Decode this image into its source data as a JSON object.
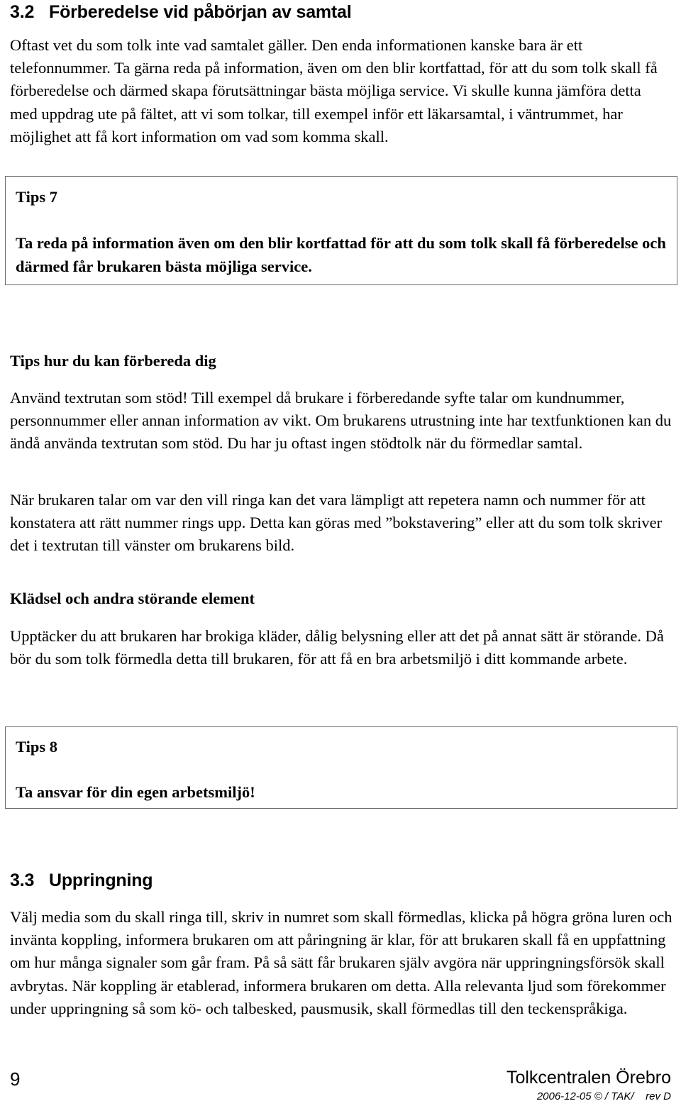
{
  "document": {
    "language": "sv",
    "page_number": "9"
  },
  "sections": {
    "s32": {
      "number": "3.2",
      "title": "Förberedelse vid påbörjan av samtal",
      "paragraph": "Oftast vet du som tolk inte vad samtalet gäller. Den enda informationen kanske bara är ett telefonnummer. Ta gärna reda på information, även om den blir kortfattad, för att du som tolk skall få förberedelse och därmed skapa förutsättningar bästa möjliga service. Vi skulle kunna jämföra detta med uppdrag ute på fältet, att vi som tolkar, till exempel inför ett läkarsamtal, i väntrummet, har möjlighet att få kort information om vad som komma skall."
    },
    "s33": {
      "number": "3.3",
      "title": "Uppringning",
      "paragraph": "Välj media som du skall ringa till, skriv in numret som skall förmedlas, klicka på högra gröna luren och invänta koppling, informera brukaren om att påringning är klar, för att brukaren skall få en uppfattning om hur många signaler som går fram. På så sätt får brukaren själv avgöra när uppringningsförsök skall avbrytas. När koppling är etablerad, informera brukaren om detta. Alla relevanta ljud som förekommer under uppringning så som kö- och talbesked, pausmusik, skall förmedlas till den teckenspråkiga."
    }
  },
  "tips": [
    {
      "title": "Tips 7",
      "text": "Ta reda på information även om den blir kortfattad för att du som tolk skall få förberedelse och därmed får brukaren bästa möjliga service."
    },
    {
      "title": "Tips 8",
      "text": "Ta ansvar för din egen arbetsmiljö!"
    }
  ],
  "subsections": {
    "forberedelse": {
      "heading": "Tips hur du kan förbereda dig",
      "paragraph1": "Använd textrutan som stöd! Till exempel då brukare i förberedande syfte talar om kundnummer, personnummer eller annan information av vikt. Om brukarens utrustning inte har textfunktionen kan du ändå använda textrutan som stöd. Du har ju oftast ingen stödtolk när du förmedlar samtal.",
      "paragraph2": "När brukaren talar om var den vill ringa kan det vara lämpligt att repetera namn och nummer för att konstatera att rätt nummer rings upp. Detta kan göras med ”bokstavering” eller att du som tolk skriver det i textrutan till vänster om brukarens bild."
    },
    "kladsel": {
      "heading": "Klädsel och andra störande element",
      "paragraph": "Upptäcker du att brukaren har brokiga kläder, dålig belysning eller att det på annat sätt är störande. Då bör du som tolk förmedla detta till brukaren, för att få en bra arbetsmiljö i ditt kommande arbete."
    }
  },
  "footer": {
    "page_number": "9",
    "organisation": "Tolkcentralen Örebro",
    "revision": "2006-12-05 © / TAK/    rev D"
  }
}
